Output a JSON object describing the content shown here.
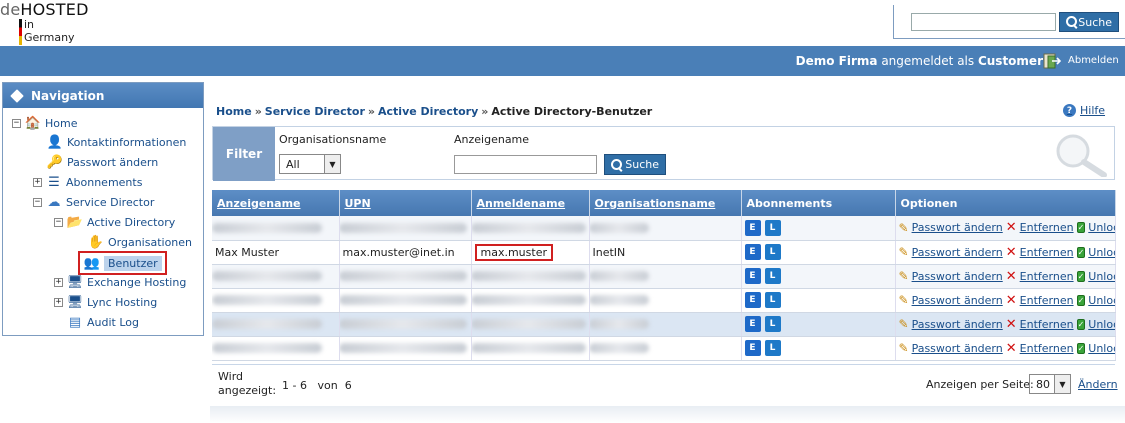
{
  "logo": {
    "de": "de",
    "hosted": "HOSTED",
    "in": "in",
    "germany": "Germany"
  },
  "top_search": {
    "value": "",
    "button": "Suche"
  },
  "user": {
    "company": "Demo Firma",
    "middle": " angemeldet als ",
    "name": "Customer",
    "logout": "Abmelden"
  },
  "nav": {
    "title": "Navigation",
    "items": [
      {
        "label": "Home"
      },
      {
        "label": "Kontaktinformationen"
      },
      {
        "label": "Passwort ändern"
      },
      {
        "label": "Abonnements"
      },
      {
        "label": "Service Director"
      },
      {
        "label": "Active Directory"
      },
      {
        "label": "Organisationen"
      },
      {
        "label": "Benutzer"
      },
      {
        "label": "Exchange Hosting"
      },
      {
        "label": "Lync Hosting"
      },
      {
        "label": "Audit Log"
      }
    ]
  },
  "breadcrumb": [
    "Home",
    "Service Director",
    "Active Directory",
    "Active Directory-Benutzer"
  ],
  "breadcrumb_sep": "»",
  "help": "Hilfe",
  "filter": {
    "title": "Filter",
    "org_label": "Organisationsname",
    "org_selected": "All",
    "name_label": "Anzeigename",
    "name_value": "",
    "button": "Suche"
  },
  "table": {
    "headers": [
      "Anzeigename",
      "UPN",
      "Anmeldename",
      "Organisationsname",
      "Abonnements",
      "Optionen"
    ],
    "rows": [
      {
        "name": "",
        "upn": "",
        "login": "",
        "org": "",
        "blurred": true
      },
      {
        "name": "Max Muster",
        "upn": "max.muster@inet.in",
        "login": "max.muster",
        "org": "InetIN",
        "blurred": false
      },
      {
        "name": "",
        "upn": "",
        "login": "",
        "org": "",
        "blurred": true
      },
      {
        "name": "",
        "upn": "",
        "login": "",
        "org": "",
        "blurred": true
      },
      {
        "name": "",
        "upn": "",
        "login": "",
        "org": "",
        "blurred": true
      },
      {
        "name": "",
        "upn": "",
        "login": "",
        "org": "",
        "blurred": true
      }
    ],
    "options": {
      "password": "Passwort ändern",
      "remove": "Entfernen",
      "unlock": "Unlock"
    }
  },
  "footer": {
    "shown_label_1": "Wird",
    "shown_label_2": "angezeigt:",
    "range_from": "1",
    "range_to": "6",
    "of_label": "von",
    "total": "6",
    "per_page_label": "Anzeigen per Seite:",
    "per_page_value": "80",
    "apply": "Ändern"
  }
}
